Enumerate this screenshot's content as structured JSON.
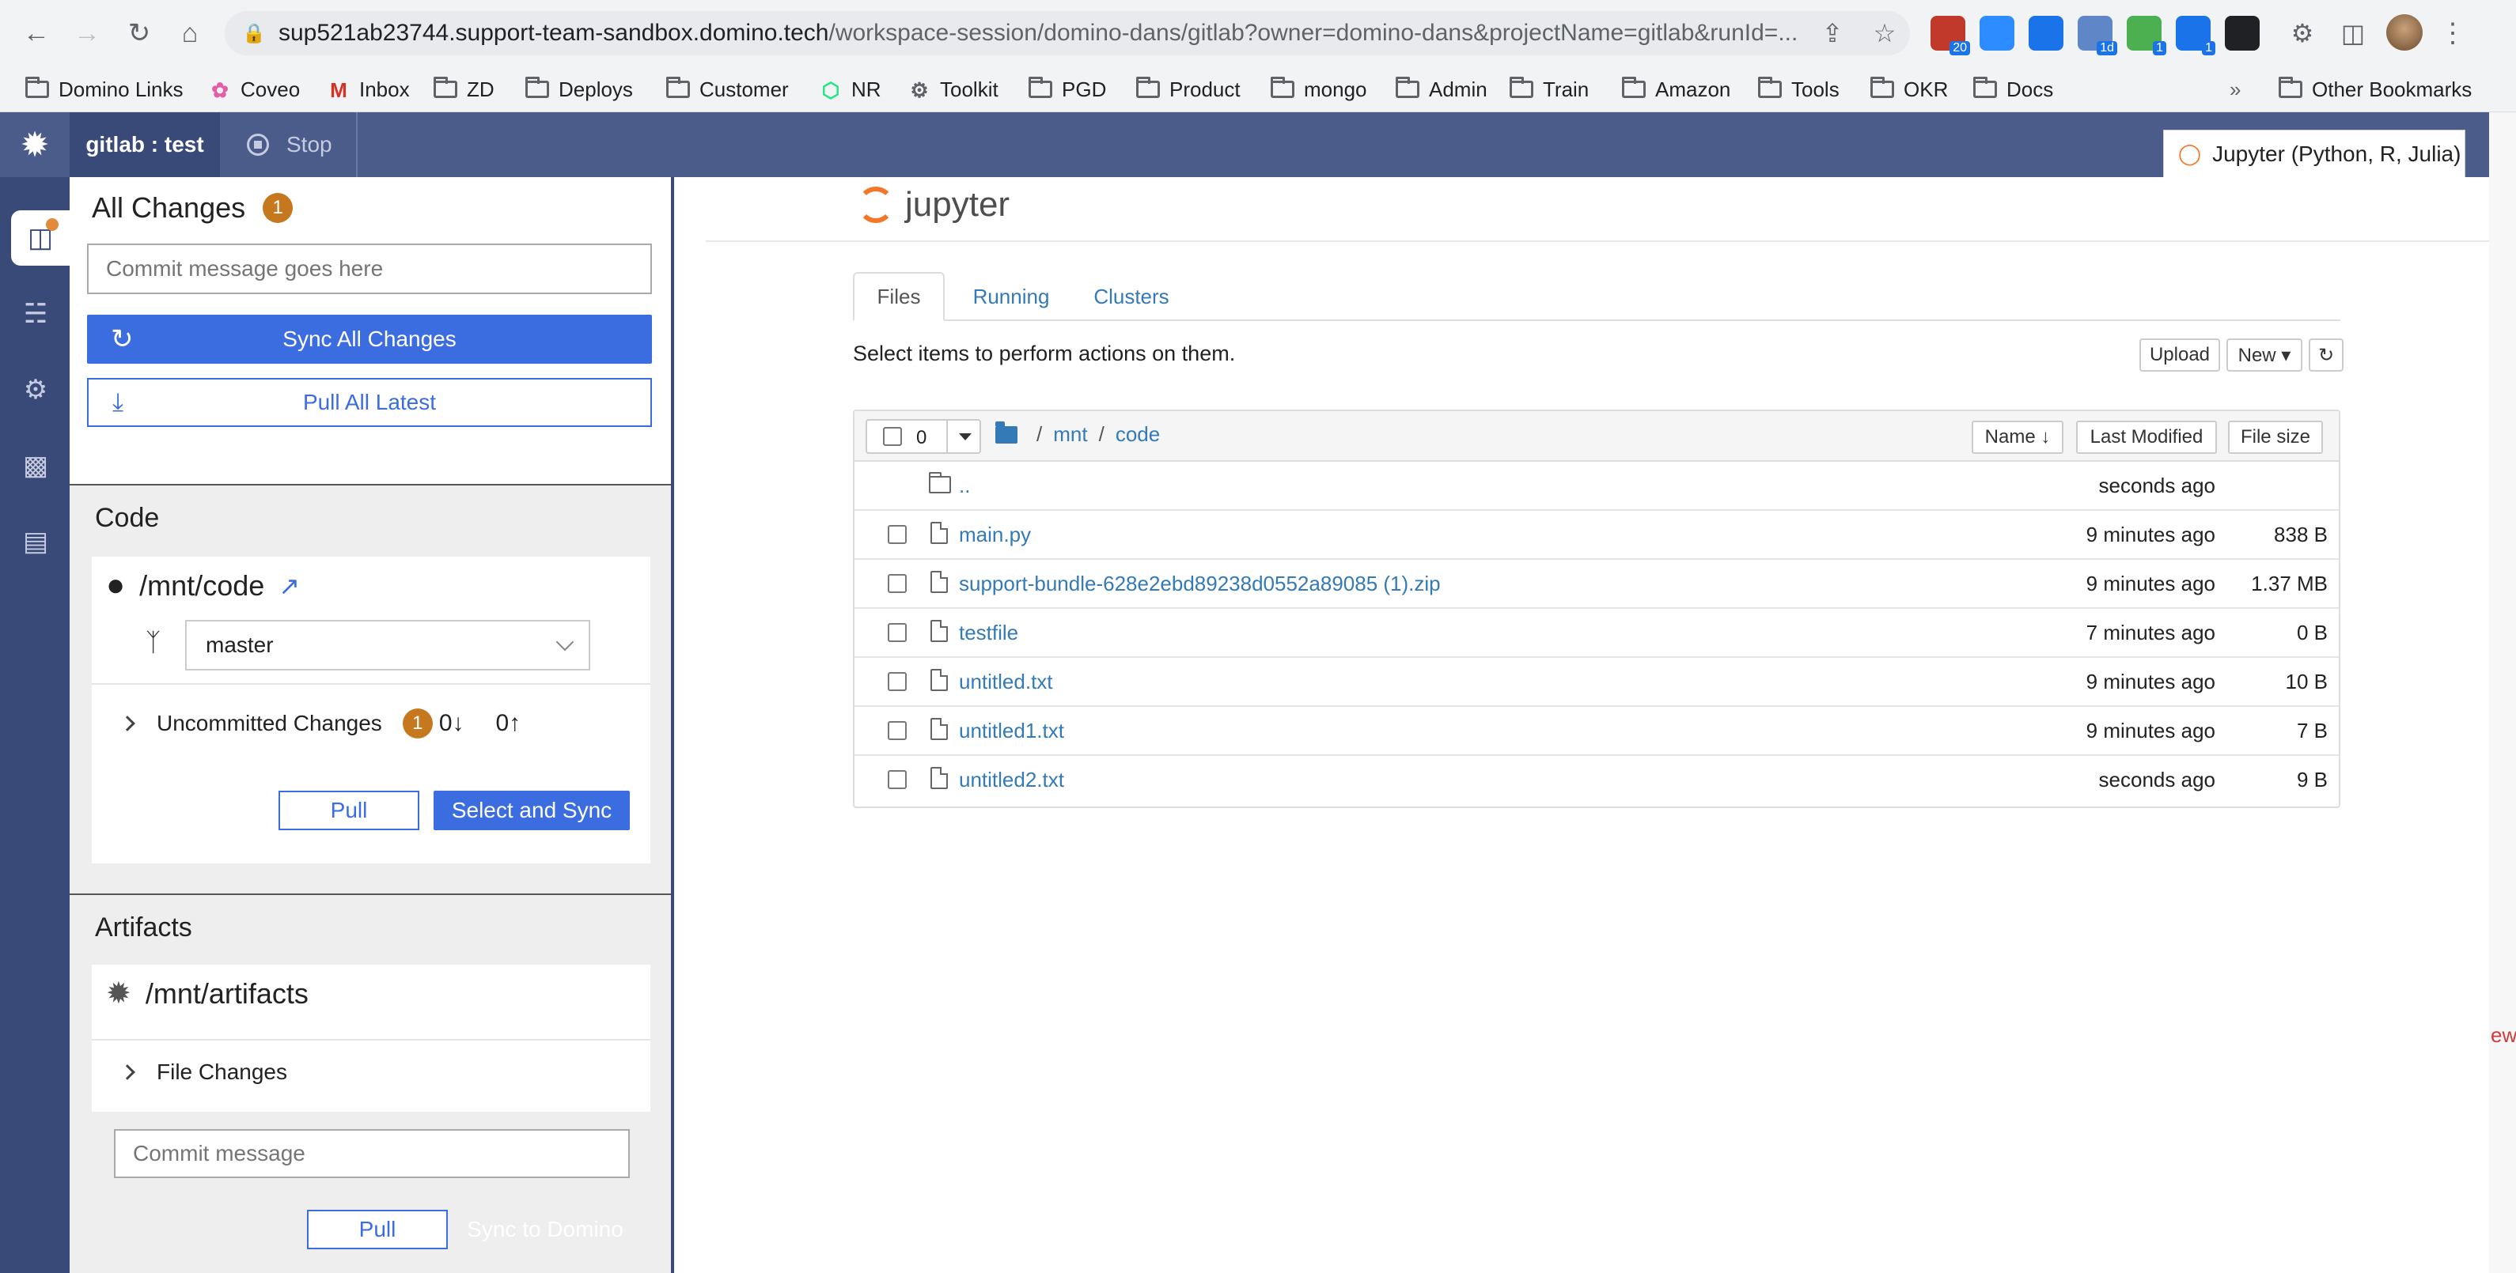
{
  "browser": {
    "url_host": "sup521ab23744.support-team-sandbox.domino.tech",
    "url_path": "/workspace-session/domino-dans/gitlab?owner=domino-dans&projectName=gitlab&runId=...",
    "extensions": [
      {
        "name": "calendar-ext",
        "badge": "20",
        "color": "#c0392b"
      },
      {
        "name": "zoom-ext",
        "badge": "",
        "color": "#2d8cff"
      },
      {
        "name": "c-ext",
        "badge": "",
        "color": "#1a73e8"
      },
      {
        "name": "grid-ext",
        "badge": "1d",
        "color": "#5f86c6"
      },
      {
        "name": "green-ext",
        "badge": "1",
        "color": "#4caf50"
      },
      {
        "name": "sync-ext",
        "badge": "1",
        "color": "#1a73e8"
      },
      {
        "name": "domino-ext",
        "badge": "",
        "color": "#202124"
      }
    ],
    "bookmarks": [
      {
        "label": "Domino Links",
        "icon": "folder"
      },
      {
        "label": "Coveo",
        "icon": "coveo"
      },
      {
        "label": "Inbox",
        "icon": "gmail"
      },
      {
        "label": "ZD",
        "icon": "folder"
      },
      {
        "label": "Deploys",
        "icon": "folder"
      },
      {
        "label": "Customer",
        "icon": "folder"
      },
      {
        "label": "NR",
        "icon": "nr"
      },
      {
        "label": "Toolkit",
        "icon": "gear"
      },
      {
        "label": "PGD",
        "icon": "folder"
      },
      {
        "label": "Product",
        "icon": "folder"
      },
      {
        "label": "mongo",
        "icon": "folder"
      },
      {
        "label": "Admin",
        "icon": "folder"
      },
      {
        "label": "Train",
        "icon": "folder"
      },
      {
        "label": "Amazon",
        "icon": "folder"
      },
      {
        "label": "Tools",
        "icon": "folder"
      },
      {
        "label": "OKR",
        "icon": "folder"
      },
      {
        "label": "Docs",
        "icon": "folder"
      }
    ],
    "overflow": "»",
    "other_bookmarks": "Other Bookmarks"
  },
  "domino": {
    "tab": "gitlab : test",
    "stop": "Stop",
    "jupyter_tab": "Jupyter (Python, R, Julia)"
  },
  "git_panel": {
    "all_changes": {
      "title": "All Changes",
      "badge": "1",
      "commit_placeholder": "Commit message goes here",
      "sync_all": "Sync All Changes",
      "pull_all": "Pull All Latest"
    },
    "code": {
      "title": "Code",
      "path": "/mnt/code",
      "branch": "master",
      "uncommitted": "Uncommitted Changes",
      "uncommitted_badge": "1",
      "behind": "0↓",
      "ahead": "0↑",
      "pull": "Pull",
      "select_sync": "Select and Sync"
    },
    "artifacts": {
      "title": "Artifacts",
      "path": "/mnt/artifacts",
      "file_changes": "File Changes",
      "commit_placeholder": "Commit message",
      "pull": "Pull",
      "sync": "Sync to Domino"
    }
  },
  "jupyter": {
    "logo": "jupyter",
    "tabs": [
      "Files",
      "Running",
      "Clusters"
    ],
    "hint": "Select items to perform actions on them.",
    "upload": "Upload",
    "new": "New ▾",
    "selected_count": "0",
    "breadcrumb": [
      "mnt",
      "code"
    ],
    "col_name": "Name ↓",
    "col_modified": "Last Modified",
    "col_size": "File size",
    "files": [
      {
        "name": "..",
        "type": "dir",
        "modified": "seconds ago",
        "size": ""
      },
      {
        "name": "main.py",
        "type": "file",
        "modified": "9 minutes ago",
        "size": "838 B"
      },
      {
        "name": "support-bundle-628e2ebd89238d0552a89085 (1).zip",
        "type": "file",
        "modified": "9 minutes ago",
        "size": "1.37 MB"
      },
      {
        "name": "testfile",
        "type": "file",
        "modified": "7 minutes ago",
        "size": "0 B"
      },
      {
        "name": "untitled.txt",
        "type": "file",
        "modified": "9 minutes ago",
        "size": "10 B"
      },
      {
        "name": "untitled1.txt",
        "type": "file",
        "modified": "9 minutes ago",
        "size": "7 B"
      },
      {
        "name": "untitled2.txt",
        "type": "file",
        "modified": "seconds ago",
        "size": "9 B"
      }
    ]
  },
  "edge_text": "ew"
}
